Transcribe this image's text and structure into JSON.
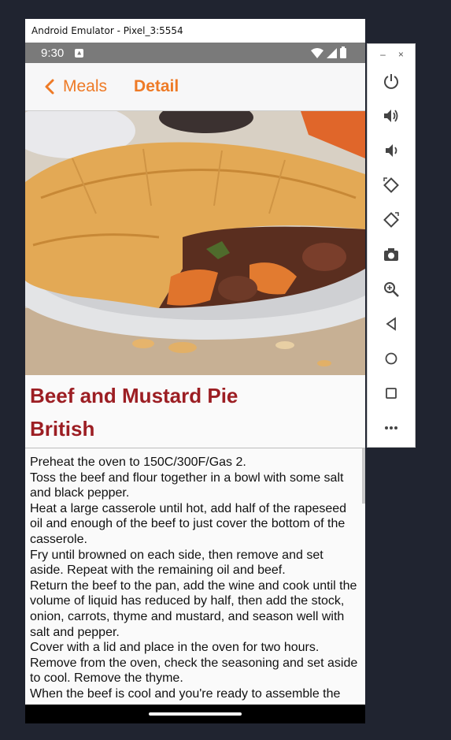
{
  "emulator": {
    "window_title": "Android Emulator - Pixel_3:5554",
    "minimize_glyph": "–",
    "close_glyph": "×"
  },
  "status_bar": {
    "time": "9:30",
    "icons": [
      "notification-icon",
      "wifi-icon",
      "signal-icon",
      "battery-icon"
    ]
  },
  "navbar": {
    "back_label": "Meals",
    "title": "Detail",
    "accent_color": "#ee7a26"
  },
  "meal": {
    "name": "Beef and Mustard Pie",
    "area": "British",
    "title_color": "#9c1e23",
    "instructions": [
      "Preheat the oven to 150C/300F/Gas 2.",
      "Toss the beef and flour together in a bowl with some salt and black pepper.",
      "Heat a large casserole until hot, add half of the rapeseed oil and enough of the beef to just cover the bottom of the casserole.",
      "Fry until browned on each side, then remove and set aside. Repeat with the remaining oil and beef.",
      "Return the beef to the pan, add the wine and cook until the volume of liquid has reduced by half, then add the stock, onion, carrots, thyme and mustard, and season well with salt and pepper.",
      "Cover with a lid and place in the oven for two hours.",
      "Remove from the oven, check the seasoning and set aside to cool. Remove the thyme.",
      "When the beef is cool and you're ready to assemble the"
    ]
  },
  "side_controls": [
    "power-icon",
    "volume-up-icon",
    "volume-down-icon",
    "rotate-left-icon",
    "rotate-right-icon",
    "camera-icon",
    "zoom-icon",
    "back-icon",
    "home-icon",
    "overview-icon",
    "more-icon"
  ]
}
